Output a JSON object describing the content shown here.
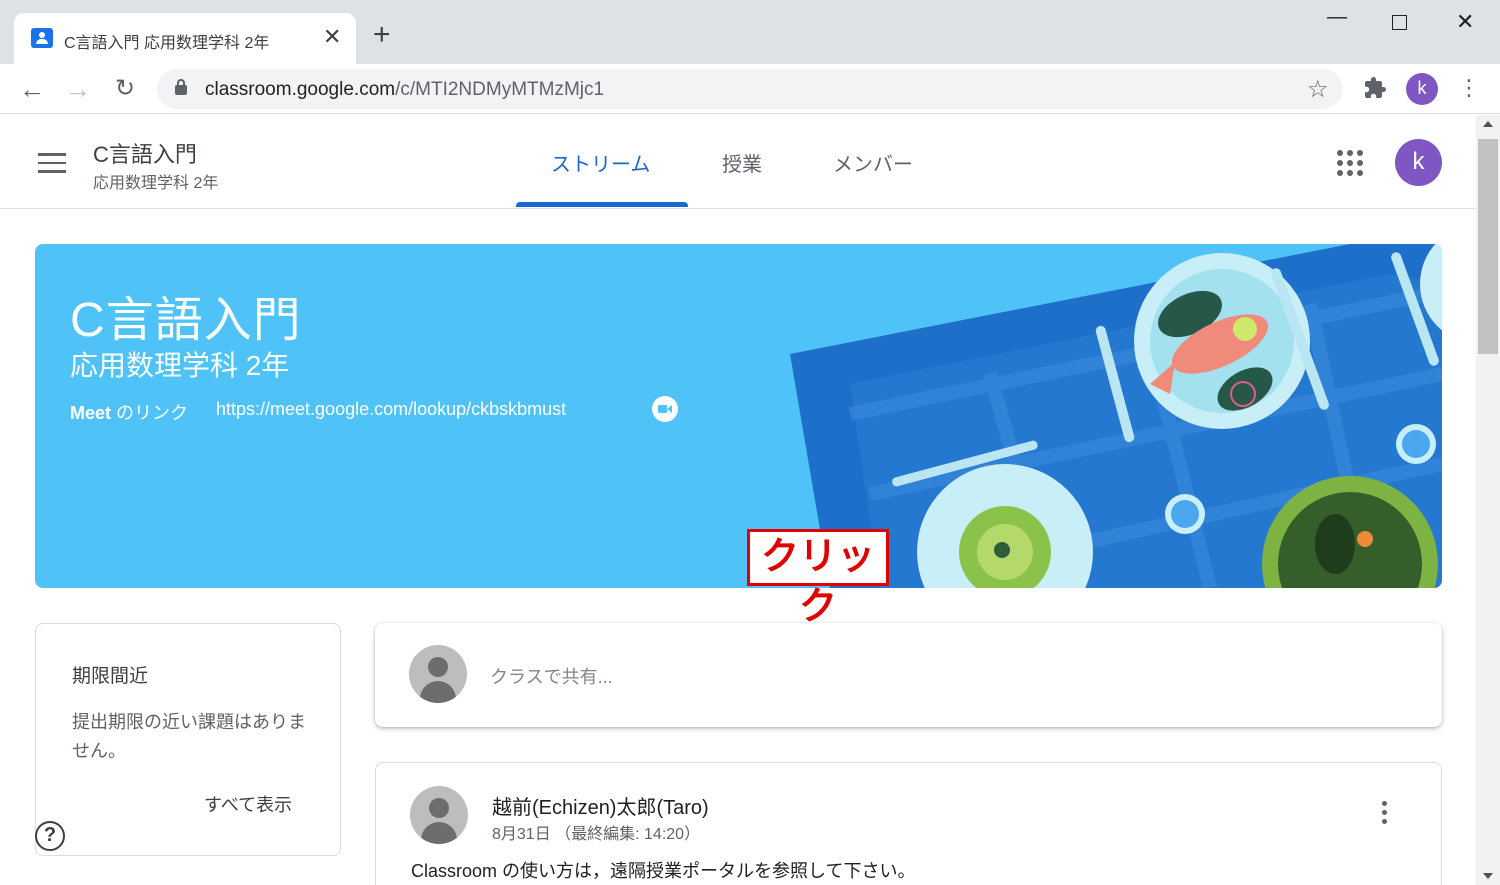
{
  "browser": {
    "tab_title": "C言語入門 応用数理学科 2年",
    "tab_close": "✕",
    "new_tab": "+",
    "url_host": "classroom.google.com",
    "url_path": "/c/MTI2NDMyMTMzMjc1",
    "profile_initial": "k"
  },
  "header": {
    "class_name": "C言語入門",
    "class_section": "応用数理学科 2年",
    "tabs": [
      {
        "label": "ストリーム",
        "active": true
      },
      {
        "label": "授業",
        "active": false
      },
      {
        "label": "メンバー",
        "active": false
      }
    ],
    "profile_initial": "k"
  },
  "banner": {
    "title": "C言語入門",
    "subtitle": "応用数理学科 2年",
    "meet_label_bold": "Meet",
    "meet_label_rest": " のリンク",
    "meet_url": "https://meet.google.com/lookup/ckbskbmust",
    "bg_color": "#4fc3f7"
  },
  "upcoming": {
    "title": "期限間近",
    "empty_text": "提出期限の近い課題はありません。",
    "view_all": "すべて表示"
  },
  "share": {
    "placeholder": "クラスで共有..."
  },
  "annotation": {
    "label": "クリック",
    "color": "#e00000"
  },
  "post": {
    "author": "越前(Echizen)太郎(Taro)",
    "date": "8月31日 （最終編集: 14:20）",
    "body": "Classroom の使い方は，遠隔授業ポータルを参照して下さい。"
  },
  "icons": {
    "help": "?",
    "star": "☆",
    "extensions": "puzzle-icon"
  }
}
